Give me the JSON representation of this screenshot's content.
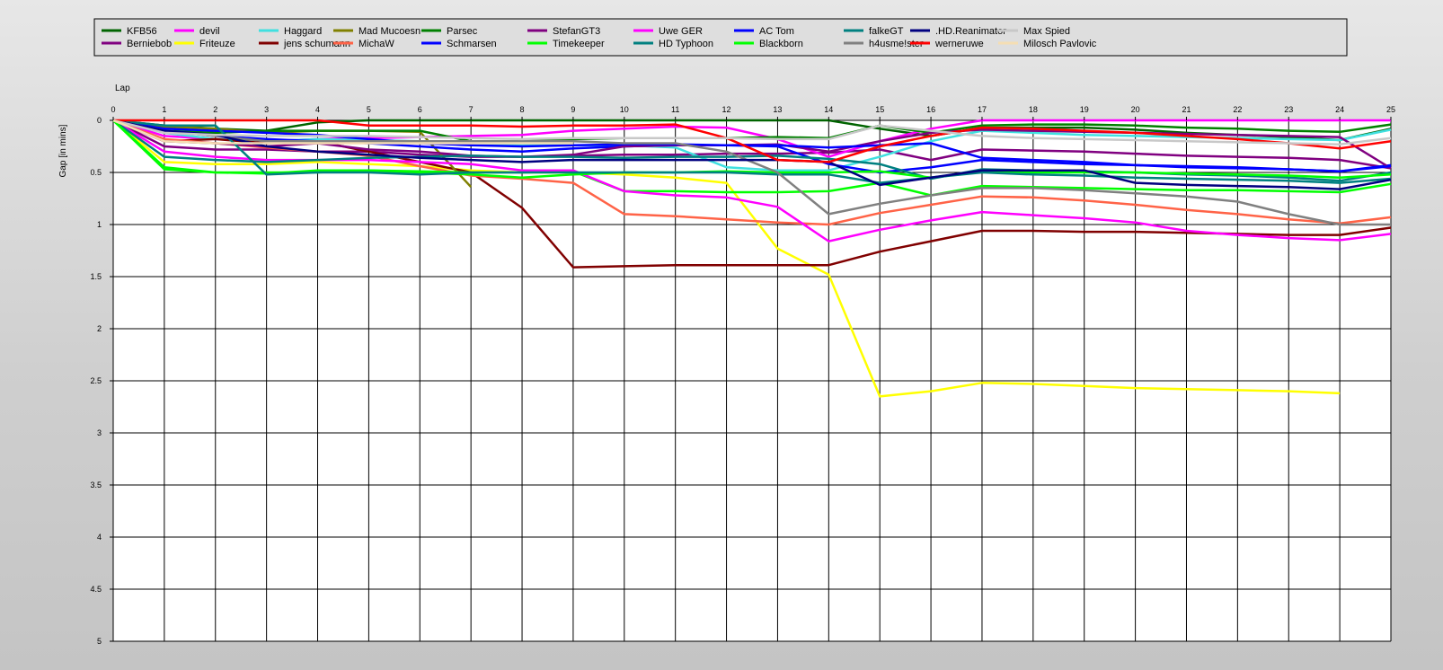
{
  "chart_data": {
    "type": "line",
    "xlabel": "Lap",
    "ylabel": "Gap [in mins]",
    "x": [
      0,
      1,
      2,
      3,
      4,
      5,
      6,
      7,
      8,
      9,
      10,
      11,
      12,
      13,
      14,
      15,
      16,
      17,
      18,
      19,
      20,
      21,
      22,
      23,
      24,
      25
    ],
    "xlim": [
      0,
      25
    ],
    "ylim": [
      0,
      5
    ],
    "y_inverted": true,
    "yticks": [
      0,
      0.5,
      1,
      1.5,
      2,
      2.5,
      3,
      3.5,
      4,
      4.5,
      5
    ],
    "ytick_labels": [
      "0",
      "0.5",
      "1",
      "1.5",
      "2",
      "2.5",
      "3",
      "3.5",
      "4",
      "4.5",
      "5"
    ],
    "grid": true,
    "legend_position": "top",
    "series": [
      {
        "name": "KFB56",
        "color": "#006400",
        "values": [
          0,
          0.05,
          0.08,
          0.1,
          0.02,
          0,
          0,
          0,
          0,
          0,
          0,
          0,
          0,
          0,
          0,
          0.08,
          0.15,
          0.07,
          0.07,
          0.07,
          0.09,
          0.12,
          0.14,
          0.16,
          0.19,
          0.08
        ]
      },
      {
        "name": "Berniebob",
        "color": "#800080",
        "values": [
          0,
          0.25,
          0.28,
          0.28,
          0.3,
          0.3,
          0.33,
          0.35,
          0.35,
          0.34,
          0.33,
          0.33,
          0.32,
          0.32,
          0.31,
          0.28,
          0.38,
          0.28,
          0.29,
          0.3,
          0.32,
          0.34,
          0.35,
          0.36,
          0.38,
          0.46
        ]
      },
      {
        "name": "devil",
        "color": "#FF00FF",
        "values": [
          0,
          0.15,
          0.18,
          0.2,
          0.18,
          0.17,
          0.16,
          0.15,
          0.14,
          0.1,
          0.08,
          0.06,
          0.07,
          0.18,
          0.35,
          0.2,
          0.08,
          0,
          0,
          0,
          0,
          0,
          0,
          0,
          0,
          0
        ]
      },
      {
        "name": "Friteuze",
        "color": "#FFFF00",
        "values": [
          0,
          0.4,
          0.42,
          0.42,
          0.4,
          0.42,
          0.44,
          0.48,
          0.5,
          0.5,
          0.52,
          0.55,
          0.6,
          1.23,
          1.48,
          2.65,
          2.6,
          2.52,
          2.53,
          2.55,
          2.57,
          2.58,
          2.59,
          2.6,
          2.62,
          null
        ]
      },
      {
        "name": "Haggard",
        "color": "#40E0E0",
        "values": [
          0,
          0.12,
          0.18,
          0.2,
          0.18,
          0.19,
          0.2,
          0.22,
          0.24,
          0.24,
          0.24,
          0.26,
          0.45,
          0.48,
          0.48,
          0.35,
          0.2,
          0.1,
          0.12,
          0.14,
          0.15,
          0.16,
          0.17,
          0.18,
          0.19,
          0.09
        ]
      },
      {
        "name": "jens  schumann",
        "color": "#800000",
        "values": [
          0,
          0.2,
          0.18,
          0.22,
          0.2,
          0.3,
          0.4,
          0.5,
          0.84,
          1.41,
          1.4,
          1.39,
          1.39,
          1.39,
          1.39,
          1.26,
          1.16,
          1.06,
          1.06,
          1.07,
          1.07,
          1.08,
          1.09,
          1.1,
          1.1,
          1.03
        ]
      },
      {
        "name": "Mad Mucoesn",
        "color": "#808000",
        "values": [
          0,
          0.06,
          0.08,
          0.12,
          0.1,
          0.1,
          0.11,
          0.64,
          null,
          null,
          null,
          null,
          null,
          null,
          null,
          null,
          null,
          null,
          null,
          null,
          null,
          null,
          null,
          null,
          null,
          null
        ]
      },
      {
        "name": "MichaW",
        "color": "#FF6347",
        "values": [
          0,
          0.18,
          0.22,
          0.26,
          0.3,
          0.34,
          0.44,
          0.53,
          0.56,
          0.6,
          0.9,
          0.92,
          0.95,
          0.98,
          1.0,
          0.89,
          0.81,
          0.73,
          0.74,
          0.77,
          0.81,
          0.86,
          0.9,
          0.95,
          0.99,
          0.93
        ]
      },
      {
        "name": "Parsec",
        "color": "#008000",
        "values": [
          0,
          0.1,
          0.12,
          0.1,
          0.1,
          0.1,
          0.1,
          0.2,
          0.2,
          0.18,
          0.17,
          0.17,
          0.17,
          0.16,
          0.17,
          0.05,
          0.12,
          0.05,
          0.04,
          0.04,
          0.05,
          0.07,
          0.08,
          0.1,
          0.11,
          0.04
        ]
      },
      {
        "name": "Schmarsen",
        "color": "#0000FF",
        "values": [
          0,
          0.1,
          0.15,
          0.18,
          0.2,
          0.22,
          0.25,
          0.28,
          0.3,
          0.27,
          0.25,
          0.24,
          0.24,
          0.25,
          0.42,
          0.5,
          0.45,
          0.38,
          0.4,
          0.42,
          0.43,
          0.44,
          0.45,
          0.47,
          0.49,
          0.43
        ]
      },
      {
        "name": "StefanGT3",
        "color": "#800080",
        "values": [
          0,
          0.2,
          0.22,
          0.25,
          0.22,
          0.28,
          0.3,
          0.34,
          0.35,
          0.33,
          0.25,
          0.24,
          0.24,
          0.23,
          0.3,
          0.2,
          0.12,
          0.09,
          0.1,
          0.11,
          0.12,
          0.13,
          0.14,
          0.15,
          0.16,
          0.46
        ]
      },
      {
        "name": "Timekeeper",
        "color": "#00FF00",
        "values": [
          0,
          0.47,
          0.5,
          0.5,
          0.5,
          0.48,
          0.49,
          0.5,
          0.5,
          0.49,
          0.68,
          0.68,
          0.69,
          0.69,
          0.68,
          0.6,
          0.72,
          0.63,
          0.64,
          0.65,
          0.66,
          0.67,
          0.67,
          0.68,
          0.69,
          0.61
        ]
      },
      {
        "name": "Uwe GER",
        "color": "#FF00FF",
        "values": [
          0,
          0.3,
          0.35,
          0.38,
          0.38,
          0.38,
          0.4,
          0.42,
          0.48,
          0.48,
          0.68,
          0.72,
          0.74,
          0.83,
          1.16,
          1.05,
          0.96,
          0.88,
          0.91,
          0.94,
          0.98,
          1.06,
          1.1,
          1.13,
          1.15,
          1.09
        ]
      },
      {
        "name": "HD Typhoon",
        "color": "#008080",
        "values": [
          0,
          0.35,
          0.38,
          0.4,
          0.38,
          0.36,
          0.35,
          0.34,
          0.35,
          0.35,
          0.36,
          0.35,
          0.35,
          0.34,
          0.37,
          0.42,
          0.56,
          0.47,
          0.48,
          0.49,
          0.5,
          0.52,
          0.53,
          0.55,
          0.58,
          0.5
        ]
      },
      {
        "name": "AC Tom",
        "color": "#0000FF",
        "values": [
          0,
          0.08,
          0.1,
          0.12,
          0.14,
          0.18,
          0.22,
          0.24,
          0.25,
          0.24,
          0.23,
          0.23,
          0.24,
          0.24,
          0.26,
          0.24,
          0.22,
          0.36,
          0.38,
          0.4,
          0.43,
          0.45,
          0.46,
          0.47,
          0.49,
          0.44
        ]
      },
      {
        "name": "Blackborn",
        "color": "#00FF00",
        "values": [
          0,
          0.45,
          0.5,
          0.51,
          0.48,
          0.48,
          0.5,
          0.52,
          0.55,
          0.52,
          0.5,
          0.5,
          0.49,
          0.5,
          0.5,
          0.49,
          0.55,
          0.49,
          0.5,
          0.5,
          0.5,
          0.51,
          0.52,
          0.53,
          0.55,
          0.52
        ]
      },
      {
        "name": "falkeGT",
        "color": "#008080",
        "values": [
          0,
          0.05,
          0.05,
          0.52,
          0.5,
          0.5,
          0.52,
          0.5,
          0.5,
          0.5,
          0.5,
          0.5,
          0.5,
          0.52,
          0.52,
          0.6,
          0.55,
          0.5,
          0.52,
          0.53,
          0.55,
          0.56,
          0.57,
          0.58,
          0.6,
          0.56
        ]
      },
      {
        "name": "h4usme!ster",
        "color": "#808080",
        "values": [
          0,
          0.1,
          0.15,
          0.2,
          0.2,
          0.2,
          0.2,
          0.2,
          0.2,
          0.2,
          0.22,
          0.22,
          0.3,
          0.5,
          0.9,
          0.8,
          0.72,
          0.65,
          0.65,
          0.67,
          0.7,
          0.73,
          0.78,
          0.9,
          1.0,
          1.0
        ]
      },
      {
        "name": ".HD.Reanimator",
        "color": "#000080",
        "values": [
          0,
          0.1,
          0.14,
          0.25,
          0.3,
          0.33,
          0.36,
          0.38,
          0.4,
          0.38,
          0.38,
          0.38,
          0.38,
          0.38,
          0.4,
          0.62,
          0.55,
          0.48,
          0.48,
          0.48,
          0.6,
          0.62,
          0.63,
          0.64,
          0.66,
          0.57
        ]
      },
      {
        "name": "werneruwe",
        "color": "#FF0000",
        "values": [
          0,
          0,
          0,
          0,
          0,
          0.05,
          0.05,
          0.05,
          0.06,
          0.05,
          0.05,
          0.04,
          0.17,
          0.38,
          0.4,
          0.25,
          0.15,
          0.07,
          0.08,
          0.1,
          0.12,
          0.15,
          0.18,
          0.22,
          0.27,
          0.2
        ]
      },
      {
        "name": "Max Spied",
        "color": "#C8C8C8",
        "values": [
          0,
          0.12,
          0.14,
          0.15,
          0.15,
          0.15,
          0.16,
          0.17,
          0.18,
          0.17,
          0.17,
          0.17,
          0.17,
          0.18,
          0.18,
          0.05,
          0.1,
          0.15,
          0.17,
          0.18,
          0.19,
          0.2,
          0.21,
          0.22,
          0.23,
          0.17
        ]
      },
      {
        "name": "Milosch Pavlovic",
        "color": "#F5DEB3",
        "values": [
          0,
          0.2,
          0.22,
          0.22,
          0.22,
          0.22,
          0.22,
          0.22,
          0.22,
          0.22,
          null,
          null,
          null,
          null,
          null,
          null,
          null,
          null,
          null,
          null,
          null,
          null,
          null,
          null,
          null,
          null
        ]
      }
    ]
  }
}
